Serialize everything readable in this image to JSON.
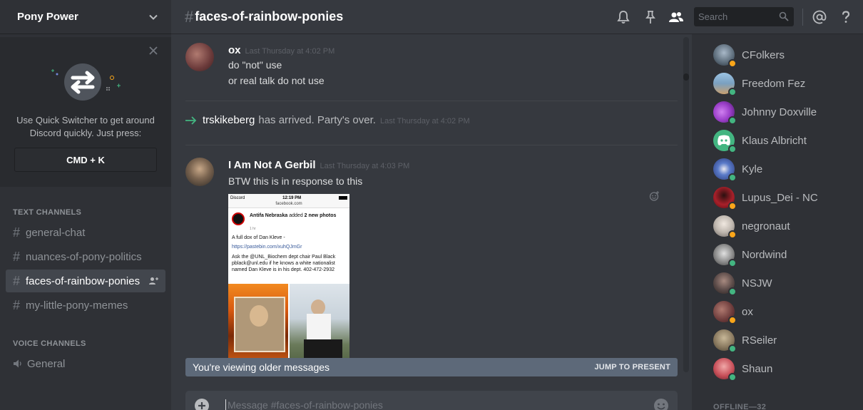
{
  "guild": {
    "name": "Pony Power"
  },
  "quick_switcher": {
    "text": "Use Quick Switcher to get around Discord quickly. Just press:",
    "shortcut": "CMD + K"
  },
  "categories": {
    "text": "TEXT CHANNELS",
    "voice": "VOICE CHANNELS"
  },
  "text_channels": [
    {
      "name": "general-chat",
      "active": false
    },
    {
      "name": "nuances-of-pony-politics",
      "active": false
    },
    {
      "name": "faces-of-rainbow-ponies",
      "active": true
    },
    {
      "name": "my-little-pony-memes",
      "active": false
    }
  ],
  "voice_channels": [
    {
      "name": "General"
    }
  ],
  "header": {
    "hash": "#",
    "channel": "faces-of-rainbow-ponies",
    "search_placeholder": "Search"
  },
  "messages": [
    {
      "author": "ox",
      "timestamp": "Last Thursday at 4:02 PM",
      "lines": [
        "do \"not\" use",
        "or real talk do not use"
      ],
      "avatar_color": "#6b3a3a"
    },
    {
      "system": true,
      "user": "trskikeberg",
      "text": "has arrived. Party's over.",
      "timestamp": "Last Thursday at 4:02 PM"
    },
    {
      "author": "I Am Not A Gerbil",
      "timestamp": "Last Thursday at 4:03 PM",
      "lines": [
        "BTW this is in response to this"
      ],
      "avatar_color": "#7a6450"
    }
  ],
  "embed": {
    "status_left": "Discord",
    "status_time": "12:19 PM",
    "url": "facebook.com",
    "post_author": "Antifa Nebraska",
    "post_action": "added",
    "post_count": "2 new photos",
    "post_meta": "1 hr",
    "line1": "A full dox of Dan Kleve -",
    "link": "https://pastebin.com/xuhQJmGr",
    "body": "Ask the @UNL_Biochem dept chair Paul Black pblack@unl.edu if he knows a white nationalist named Dan Kleve is in his dept. 402-472-2932"
  },
  "banner": {
    "text": "You're viewing older messages",
    "jump": "JUMP TO PRESENT"
  },
  "composer": {
    "placeholder": "Message #faces-of-rainbow-ponies"
  },
  "members": [
    {
      "name": "CFolkers",
      "status": "idle",
      "avatar_color": "#5a6a78"
    },
    {
      "name": "Freedom Fez",
      "status": "online",
      "avatar_color": "#7aa0c0"
    },
    {
      "name": "Johnny Doxville",
      "status": "online",
      "avatar_color": "#9b3fc9"
    },
    {
      "name": "Klaus Albricht",
      "status": "online",
      "avatar_color": "#43b581"
    },
    {
      "name": "Kyle",
      "status": "online",
      "avatar_color": "#3a5fa8"
    },
    {
      "name": "Lupus_Dei - NC",
      "status": "idle",
      "avatar_color": "#a8202a"
    },
    {
      "name": "negronaut",
      "status": "idle",
      "avatar_color": "#c0b8b0"
    },
    {
      "name": "Nordwind",
      "status": "online",
      "avatar_color": "#8a8a8a"
    },
    {
      "name": "NSJW",
      "status": "online",
      "avatar_color": "#5a4a48"
    },
    {
      "name": "ox",
      "status": "idle",
      "avatar_color": "#6b3a3a"
    },
    {
      "name": "RSeiler",
      "status": "online",
      "avatar_color": "#8a7a60"
    },
    {
      "name": "Shaun",
      "status": "online",
      "avatar_color": "#c8505a"
    }
  ],
  "offline_label": "OFFLINE—32",
  "colors": {
    "online": "#43b581",
    "idle": "#faa61a",
    "accent": "#43b581"
  }
}
